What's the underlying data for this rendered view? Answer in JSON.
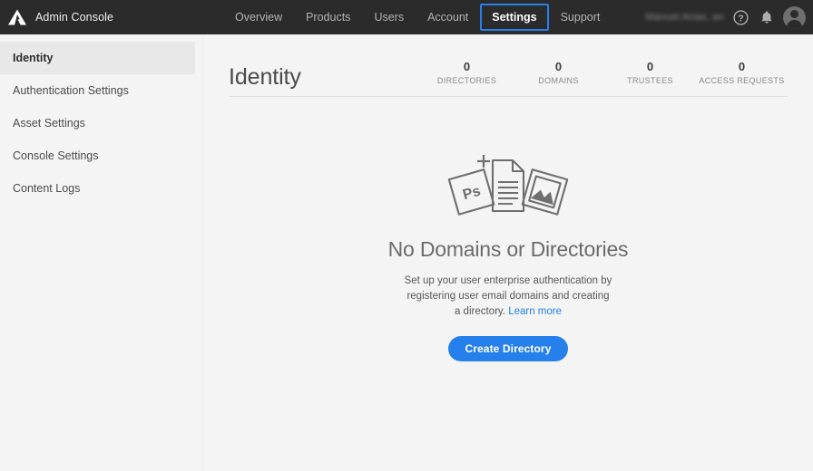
{
  "topbar": {
    "logo_icon": "adobe-logo-icon",
    "brand_title": "Admin Console",
    "nav": [
      {
        "label": "Overview",
        "active": false
      },
      {
        "label": "Products",
        "active": false
      },
      {
        "label": "Users",
        "active": false
      },
      {
        "label": "Account",
        "active": false
      },
      {
        "label": "Settings",
        "active": true
      },
      {
        "label": "Support",
        "active": false
      }
    ],
    "user_name": "Manuel Arias, an",
    "help_icon": "help-question-icon",
    "bell_icon": "notification-bell-icon",
    "avatar_icon": "user-avatar-icon",
    "accent_color": "#2680eb",
    "bar_color": "#2b2b2b"
  },
  "sidebar": {
    "items": [
      {
        "label": "Identity",
        "active": true
      },
      {
        "label": "Authentication Settings",
        "active": false
      },
      {
        "label": "Asset Settings",
        "active": false
      },
      {
        "label": "Console Settings",
        "active": false
      },
      {
        "label": "Content Logs",
        "active": false
      }
    ]
  },
  "main": {
    "page_title": "Identity",
    "stats": [
      {
        "value": "0",
        "label": "DIRECTORIES"
      },
      {
        "value": "0",
        "label": "DOMAINS"
      },
      {
        "value": "0",
        "label": "TRUSTEES"
      },
      {
        "value": "0",
        "label": "ACCESS REQUESTS"
      }
    ],
    "empty_state": {
      "illustration_icon": "documents-illustration-icon",
      "ps_card_label": "Ps",
      "title": "No Domains or Directories",
      "description": "Set up your user enterprise authentication by registering user email domains and creating a directory.",
      "learn_more_label": "Learn more",
      "cta_label": "Create Directory"
    }
  }
}
